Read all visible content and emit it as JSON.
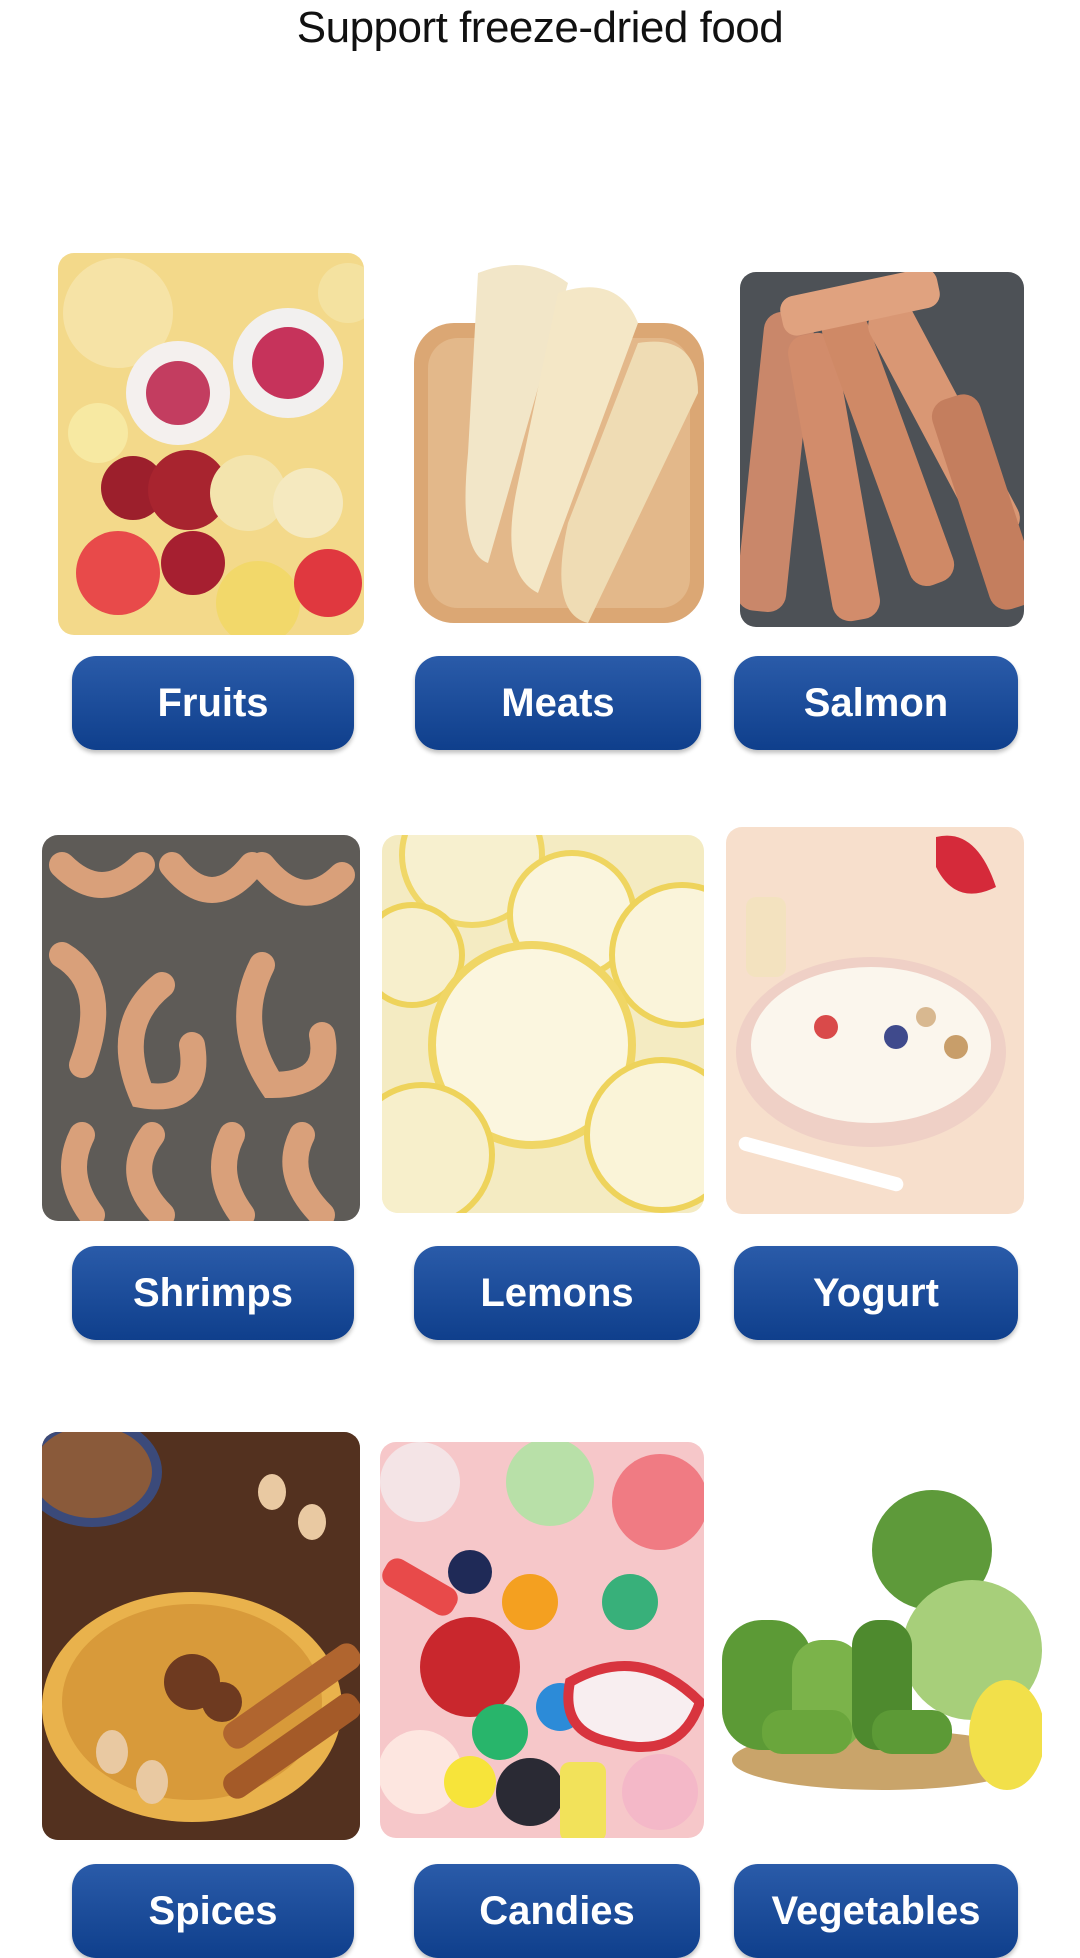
{
  "page": {
    "title": "Support freeze-dried food"
  },
  "categories": [
    {
      "label": "Fruits",
      "image_icon": "fruit-mix-photo"
    },
    {
      "label": "Meats",
      "image_icon": "dried-meat-photo"
    },
    {
      "label": "Salmon",
      "image_icon": "salmon-strips-photo"
    },
    {
      "label": "Shrimps",
      "image_icon": "shrimps-photo"
    },
    {
      "label": "Lemons",
      "image_icon": "lemon-slices-photo"
    },
    {
      "label": "Yogurt",
      "image_icon": "yogurt-bowl-photo"
    },
    {
      "label": "Spices",
      "image_icon": "spices-photo"
    },
    {
      "label": "Candies",
      "image_icon": "candies-photo"
    },
    {
      "label": "Vegetables",
      "image_icon": "vegetables-photo"
    }
  ],
  "colors": {
    "button": "#1a4d9c",
    "button_text": "#ffffff"
  }
}
